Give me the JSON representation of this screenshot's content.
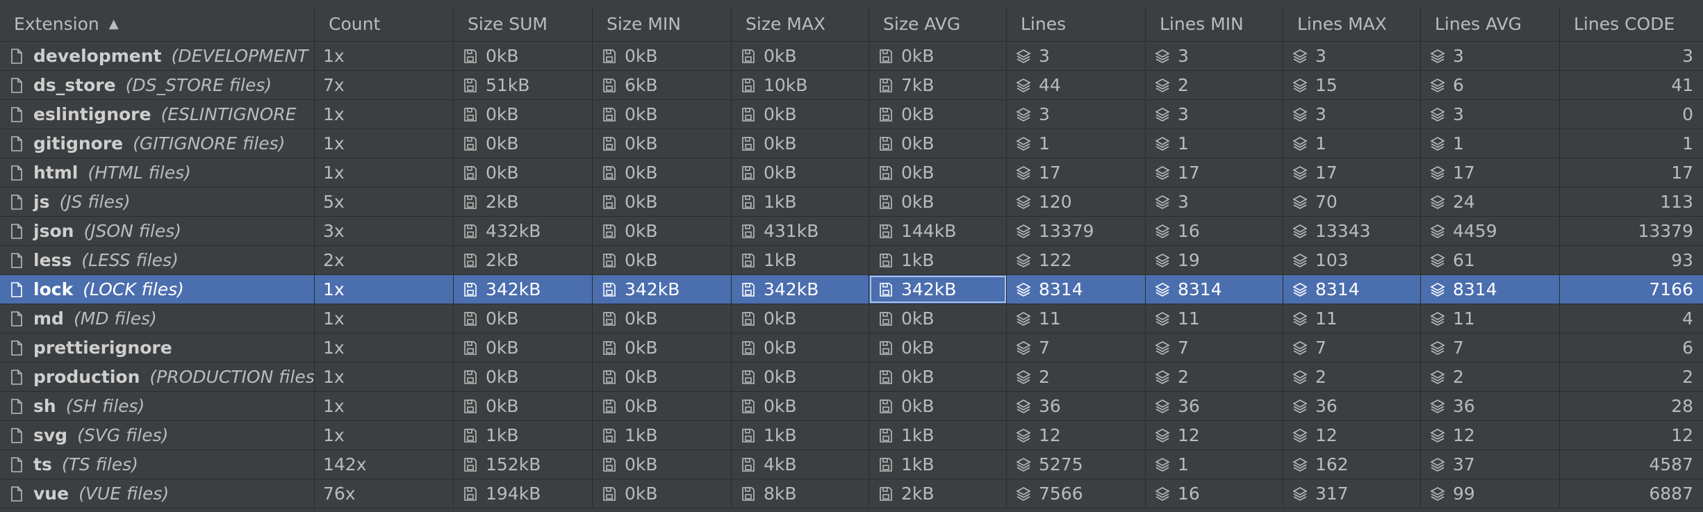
{
  "columns": [
    "Extension",
    "Count",
    "Size SUM",
    "Size MIN",
    "Size MAX",
    "Size AVG",
    "Lines",
    "Lines MIN",
    "Lines MAX",
    "Lines AVG",
    "Lines CODE"
  ],
  "sort_indicator": "▲",
  "rows": [
    {
      "name": "development",
      "desc": "(DEVELOPMENT",
      "count": "1x",
      "size_sum": "0kB",
      "size_min": "0kB",
      "size_max": "0kB",
      "size_avg": "0kB",
      "lines": "3",
      "lines_min": "3",
      "lines_max": "3",
      "lines_avg": "3",
      "lines_code": "3"
    },
    {
      "name": "ds_store",
      "desc": "(DS_STORE files)",
      "count": "7x",
      "size_sum": "51kB",
      "size_min": "6kB",
      "size_max": "10kB",
      "size_avg": "7kB",
      "lines": "44",
      "lines_min": "2",
      "lines_max": "15",
      "lines_avg": "6",
      "lines_code": "41"
    },
    {
      "name": "eslintignore",
      "desc": "(ESLINTIGNORE",
      "count": "1x",
      "size_sum": "0kB",
      "size_min": "0kB",
      "size_max": "0kB",
      "size_avg": "0kB",
      "lines": "3",
      "lines_min": "3",
      "lines_max": "3",
      "lines_avg": "3",
      "lines_code": "0"
    },
    {
      "name": "gitignore",
      "desc": "(GITIGNORE files)",
      "count": "1x",
      "size_sum": "0kB",
      "size_min": "0kB",
      "size_max": "0kB",
      "size_avg": "0kB",
      "lines": "1",
      "lines_min": "1",
      "lines_max": "1",
      "lines_avg": "1",
      "lines_code": "1"
    },
    {
      "name": "html",
      "desc": "(HTML files)",
      "count": "1x",
      "size_sum": "0kB",
      "size_min": "0kB",
      "size_max": "0kB",
      "size_avg": "0kB",
      "lines": "17",
      "lines_min": "17",
      "lines_max": "17",
      "lines_avg": "17",
      "lines_code": "17"
    },
    {
      "name": "js",
      "desc": "(JS files)",
      "count": "5x",
      "size_sum": "2kB",
      "size_min": "0kB",
      "size_max": "1kB",
      "size_avg": "0kB",
      "lines": "120",
      "lines_min": "3",
      "lines_max": "70",
      "lines_avg": "24",
      "lines_code": "113"
    },
    {
      "name": "json",
      "desc": "(JSON files)",
      "count": "3x",
      "size_sum": "432kB",
      "size_min": "0kB",
      "size_max": "431kB",
      "size_avg": "144kB",
      "lines": "13379",
      "lines_min": "16",
      "lines_max": "13343",
      "lines_avg": "4459",
      "lines_code": "13379"
    },
    {
      "name": "less",
      "desc": "(LESS files)",
      "count": "2x",
      "size_sum": "2kB",
      "size_min": "0kB",
      "size_max": "1kB",
      "size_avg": "1kB",
      "lines": "122",
      "lines_min": "19",
      "lines_max": "103",
      "lines_avg": "61",
      "lines_code": "93"
    },
    {
      "name": "lock",
      "desc": "(LOCK files)",
      "count": "1x",
      "size_sum": "342kB",
      "size_min": "342kB",
      "size_max": "342kB",
      "size_avg": "342kB",
      "lines": "8314",
      "lines_min": "8314",
      "lines_max": "8314",
      "lines_avg": "8314",
      "lines_code": "7166",
      "selected": true
    },
    {
      "name": "md",
      "desc": "(MD files)",
      "count": "1x",
      "size_sum": "0kB",
      "size_min": "0kB",
      "size_max": "0kB",
      "size_avg": "0kB",
      "lines": "11",
      "lines_min": "11",
      "lines_max": "11",
      "lines_avg": "11",
      "lines_code": "4"
    },
    {
      "name": "prettierignore",
      "desc": "",
      "count": "1x",
      "size_sum": "0kB",
      "size_min": "0kB",
      "size_max": "0kB",
      "size_avg": "0kB",
      "lines": "7",
      "lines_min": "7",
      "lines_max": "7",
      "lines_avg": "7",
      "lines_code": "6"
    },
    {
      "name": "production",
      "desc": "(PRODUCTION files)",
      "count": "1x",
      "size_sum": "0kB",
      "size_min": "0kB",
      "size_max": "0kB",
      "size_avg": "0kB",
      "lines": "2",
      "lines_min": "2",
      "lines_max": "2",
      "lines_avg": "2",
      "lines_code": "2"
    },
    {
      "name": "sh",
      "desc": "(SH files)",
      "count": "1x",
      "size_sum": "0kB",
      "size_min": "0kB",
      "size_max": "0kB",
      "size_avg": "0kB",
      "lines": "36",
      "lines_min": "36",
      "lines_max": "36",
      "lines_avg": "36",
      "lines_code": "28"
    },
    {
      "name": "svg",
      "desc": "(SVG files)",
      "count": "1x",
      "size_sum": "1kB",
      "size_min": "1kB",
      "size_max": "1kB",
      "size_avg": "1kB",
      "lines": "12",
      "lines_min": "12",
      "lines_max": "12",
      "lines_avg": "12",
      "lines_code": "12"
    },
    {
      "name": "ts",
      "desc": "(TS files)",
      "count": "142x",
      "size_sum": "152kB",
      "size_min": "0kB",
      "size_max": "4kB",
      "size_avg": "1kB",
      "lines": "5275",
      "lines_min": "1",
      "lines_max": "162",
      "lines_avg": "37",
      "lines_code": "4587"
    },
    {
      "name": "vue",
      "desc": "(VUE files)",
      "count": "76x",
      "size_sum": "194kB",
      "size_min": "0kB",
      "size_max": "8kB",
      "size_avg": "2kB",
      "lines": "7566",
      "lines_min": "16",
      "lines_max": "317",
      "lines_avg": "99",
      "lines_code": "6887"
    }
  ],
  "icons": {
    "file": "file-icon",
    "size": "disk-icon",
    "lines": "layers-icon"
  },
  "colors": {
    "background": "#3c3f41",
    "selection": "#4b6eaf",
    "grid": "#2b2b2b",
    "text": "#bbbbbb"
  }
}
